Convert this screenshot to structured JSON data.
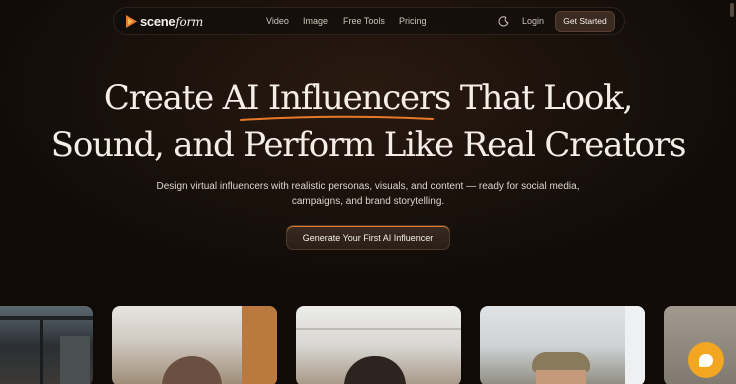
{
  "brand": {
    "name_bold": "scene",
    "name_script": "form"
  },
  "nav": {
    "links": [
      "Video",
      "Image",
      "Free Tools",
      "Pricing"
    ],
    "login": "Login",
    "get_started": "Get Started"
  },
  "hero": {
    "headline_line1": "Create AI Influencers That Look,",
    "headline_line2": "Sound, and Perform Like Real Creators",
    "subtitle_line1": "Design virtual influencers with realistic personas, visuals, and content — ready for social media,",
    "subtitle_line2": "campaigns, and brand storytelling.",
    "cta": "Generate Your First AI Influencer"
  },
  "colors": {
    "accent": "#e8782a",
    "chat": "#f2a622",
    "background": "#110b08"
  },
  "icons": {
    "theme_toggle": "moon-icon",
    "chat": "chat-icon"
  }
}
